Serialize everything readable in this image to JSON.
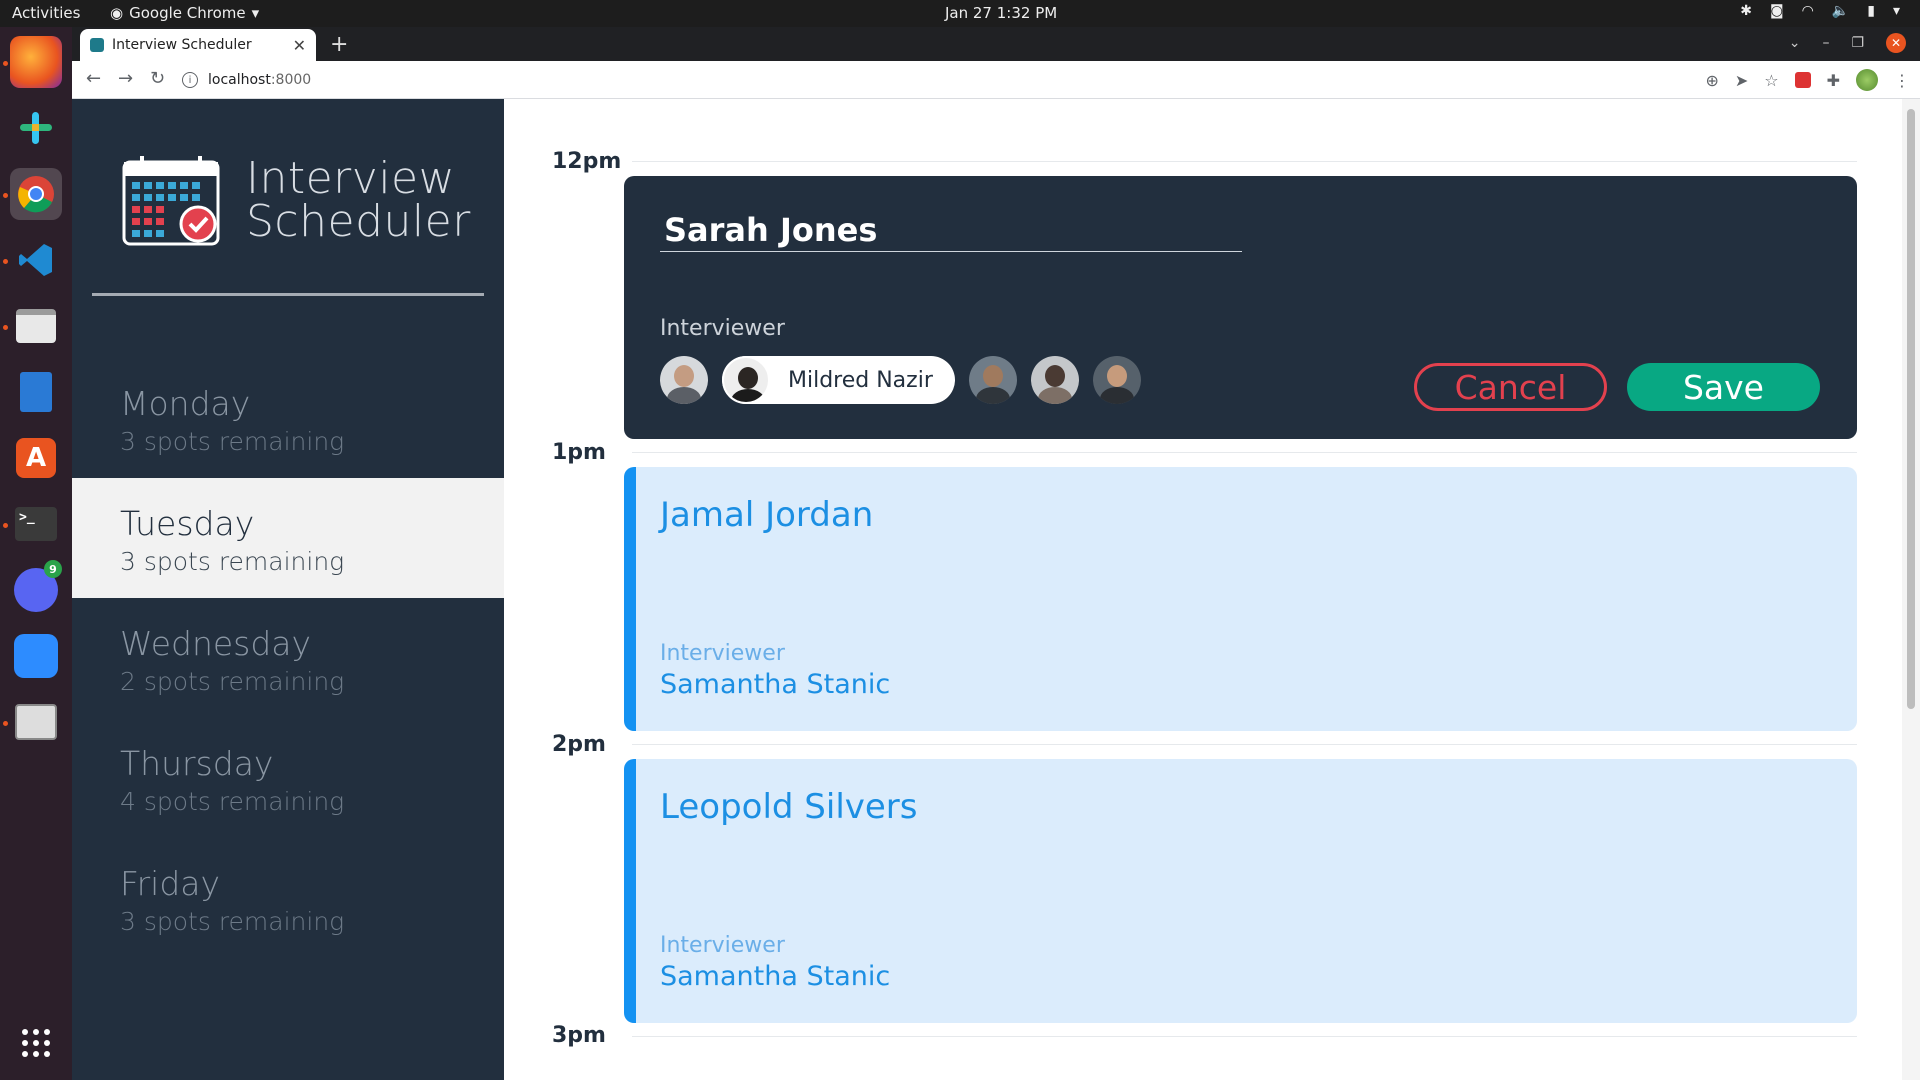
{
  "system": {
    "activities": "Activities",
    "app_name": "Google Chrome",
    "clock": "Jan 27  1:32 PM"
  },
  "browser": {
    "tab_title": "Interview Scheduler",
    "url_host": "localhost",
    "url_port": ":8000"
  },
  "dock": {
    "discord_badge": "9"
  },
  "sidebar": {
    "logo_line1": "Interview",
    "logo_line2": "Scheduler",
    "days": [
      {
        "name": "Monday",
        "spots": "3 spots remaining"
      },
      {
        "name": "Tuesday",
        "spots": "3 spots remaining"
      },
      {
        "name": "Wednesday",
        "spots": "2 spots remaining"
      },
      {
        "name": "Thursday",
        "spots": "4 spots remaining"
      },
      {
        "name": "Friday",
        "spots": "3 spots remaining"
      }
    ],
    "selected_day": "Tuesday"
  },
  "schedule": {
    "hours": [
      "12pm",
      "1pm",
      "2pm",
      "3pm"
    ],
    "form": {
      "student_value": "Sarah Jones",
      "interviewer_label": "Interviewer",
      "selected_interviewer": "Mildred Nazir",
      "cancel_label": "Cancel",
      "save_label": "Save"
    },
    "appointments": [
      {
        "student": "Jamal Jordan",
        "interviewer_label": "Interviewer",
        "interviewer": "Samantha Stanic"
      },
      {
        "student": "Leopold Silvers",
        "interviewer_label": "Interviewer",
        "interviewer": "Samantha Stanic"
      }
    ]
  },
  "colors": {
    "sidebar_bg": "#222f3e",
    "form_bg": "#222f3e",
    "save_green": "#08a883",
    "cancel_red": "#e3414e",
    "appt_bg": "#dbecfc",
    "appt_accent": "#1492f2"
  }
}
